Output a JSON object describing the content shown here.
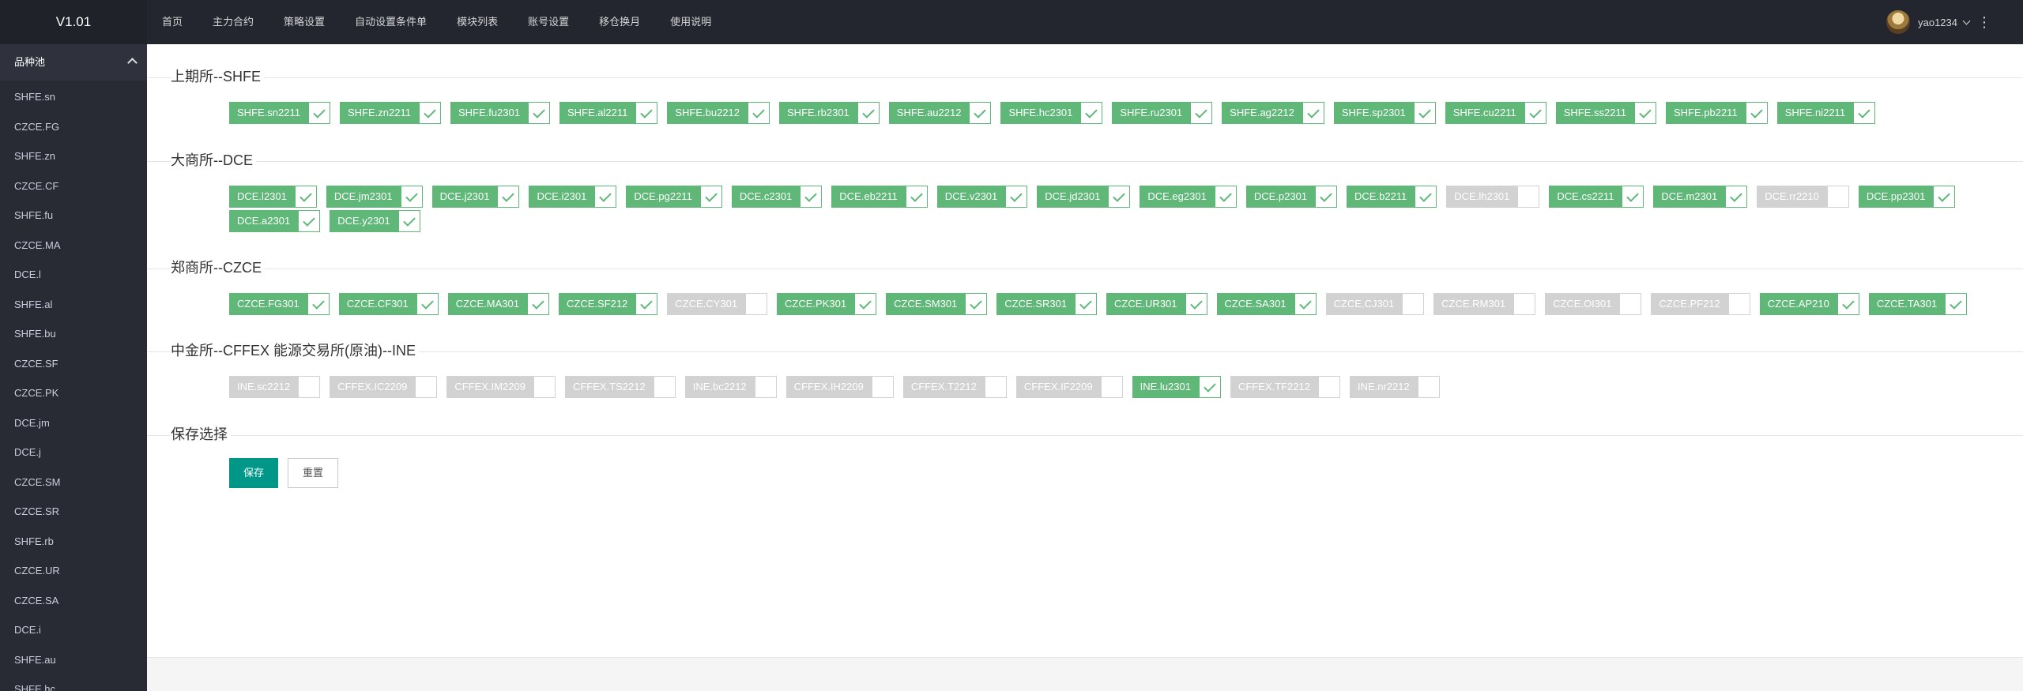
{
  "app": {
    "version": "V1.01"
  },
  "nav": [
    "首页",
    "主力合约",
    "策略设置",
    "自动设置条件单",
    "模块列表",
    "账号设置",
    "移仓换月",
    "使用说明"
  ],
  "user": {
    "name": "yao1234",
    "more_icon": "⋮"
  },
  "sidebar": {
    "group_title": "品种池",
    "items": [
      "SHFE.sn",
      "CZCE.FG",
      "SHFE.zn",
      "CZCE.CF",
      "SHFE.fu",
      "CZCE.MA",
      "DCE.l",
      "SHFE.al",
      "SHFE.bu",
      "CZCE.SF",
      "CZCE.PK",
      "DCE.jm",
      "DCE.j",
      "CZCE.SM",
      "CZCE.SR",
      "SHFE.rb",
      "CZCE.UR",
      "CZCE.SA",
      "DCE.i",
      "SHFE.au",
      "SHFE.hc"
    ]
  },
  "colors": {
    "checked": "#5fb878",
    "unchecked": "#d2d2d2",
    "primary_button": "#009688"
  },
  "sections": [
    {
      "title": "上期所--SHFE",
      "contracts": [
        {
          "label": "SHFE.sn2211",
          "checked": true
        },
        {
          "label": "SHFE.zn2211",
          "checked": true
        },
        {
          "label": "SHFE.fu2301",
          "checked": true
        },
        {
          "label": "SHFE.al2211",
          "checked": true
        },
        {
          "label": "SHFE.bu2212",
          "checked": true
        },
        {
          "label": "SHFE.rb2301",
          "checked": true
        },
        {
          "label": "SHFE.au2212",
          "checked": true
        },
        {
          "label": "SHFE.hc2301",
          "checked": true
        },
        {
          "label": "SHFE.ru2301",
          "checked": true
        },
        {
          "label": "SHFE.ag2212",
          "checked": true
        },
        {
          "label": "SHFE.sp2301",
          "checked": true
        },
        {
          "label": "SHFE.cu2211",
          "checked": true
        },
        {
          "label": "SHFE.ss2211",
          "checked": true
        },
        {
          "label": "SHFE.pb2211",
          "checked": true
        },
        {
          "label": "SHFE.ni2211",
          "checked": true
        }
      ]
    },
    {
      "title": "大商所--DCE",
      "contracts": [
        {
          "label": "DCE.l2301",
          "checked": true
        },
        {
          "label": "DCE.jm2301",
          "checked": true
        },
        {
          "label": "DCE.j2301",
          "checked": true
        },
        {
          "label": "DCE.i2301",
          "checked": true
        },
        {
          "label": "DCE.pg2211",
          "checked": true
        },
        {
          "label": "DCE.c2301",
          "checked": true
        },
        {
          "label": "DCE.eb2211",
          "checked": true
        },
        {
          "label": "DCE.v2301",
          "checked": true
        },
        {
          "label": "DCE.jd2301",
          "checked": true
        },
        {
          "label": "DCE.eg2301",
          "checked": true
        },
        {
          "label": "DCE.p2301",
          "checked": true
        },
        {
          "label": "DCE.b2211",
          "checked": true
        },
        {
          "label": "DCE.lh2301",
          "checked": false
        },
        {
          "label": "DCE.cs2211",
          "checked": true
        },
        {
          "label": "DCE.m2301",
          "checked": true
        },
        {
          "label": "DCE.rr2210",
          "checked": false
        },
        {
          "label": "DCE.pp2301",
          "checked": true
        },
        {
          "label": "DCE.a2301",
          "checked": true
        },
        {
          "label": "DCE.y2301",
          "checked": true
        }
      ]
    },
    {
      "title": "郑商所--CZCE",
      "contracts": [
        {
          "label": "CZCE.FG301",
          "checked": true
        },
        {
          "label": "CZCE.CF301",
          "checked": true
        },
        {
          "label": "CZCE.MA301",
          "checked": true
        },
        {
          "label": "CZCE.SF212",
          "checked": true
        },
        {
          "label": "CZCE.CY301",
          "checked": false
        },
        {
          "label": "CZCE.PK301",
          "checked": true
        },
        {
          "label": "CZCE.SM301",
          "checked": true
        },
        {
          "label": "CZCE.SR301",
          "checked": true
        },
        {
          "label": "CZCE.UR301",
          "checked": true
        },
        {
          "label": "CZCE.SA301",
          "checked": true
        },
        {
          "label": "CZCE.CJ301",
          "checked": false
        },
        {
          "label": "CZCE.RM301",
          "checked": false
        },
        {
          "label": "CZCE.OI301",
          "checked": false
        },
        {
          "label": "CZCE.PF212",
          "checked": false
        },
        {
          "label": "CZCE.AP210",
          "checked": true
        },
        {
          "label": "CZCE.TA301",
          "checked": true
        }
      ]
    },
    {
      "title": "中金所--CFFEX 能源交易所(原油)--INE",
      "contracts": [
        {
          "label": "INE.sc2212",
          "checked": false
        },
        {
          "label": "CFFEX.IC2209",
          "checked": false
        },
        {
          "label": "CFFEX.IM2209",
          "checked": false
        },
        {
          "label": "CFFEX.TS2212",
          "checked": false
        },
        {
          "label": "INE.bc2212",
          "checked": false
        },
        {
          "label": "CFFEX.IH2209",
          "checked": false
        },
        {
          "label": "CFFEX.T2212",
          "checked": false
        },
        {
          "label": "CFFEX.IF2209",
          "checked": false
        },
        {
          "label": "INE.lu2301",
          "checked": true
        },
        {
          "label": "CFFEX.TF2212",
          "checked": false
        },
        {
          "label": "INE.nr2212",
          "checked": false
        }
      ]
    }
  ],
  "save_section": {
    "title": "保存选择",
    "save_label": "保存",
    "reset_label": "重置"
  }
}
